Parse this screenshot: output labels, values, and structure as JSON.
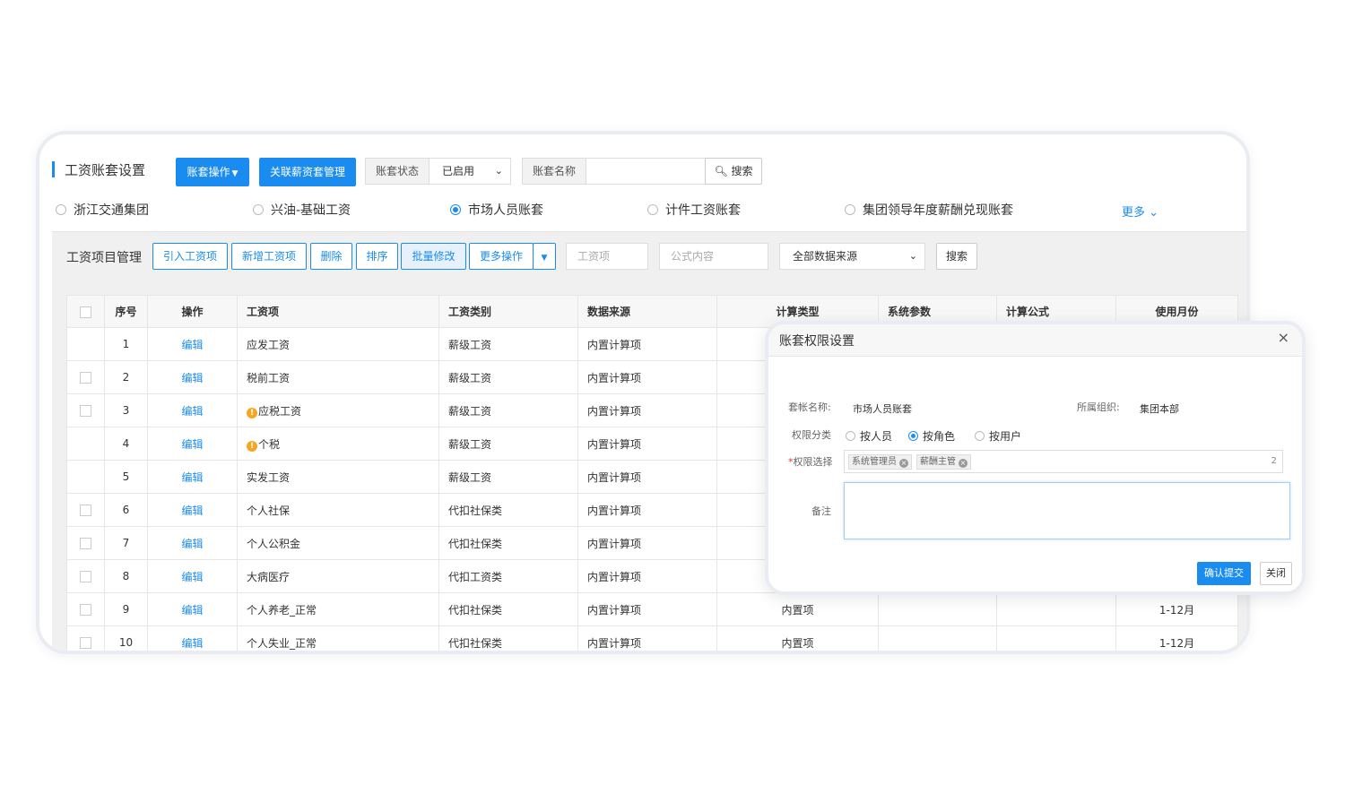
{
  "header": {
    "title": "工资账套设置",
    "account_ops_label": "账套操作",
    "link_manage_label": "关联薪资套管理",
    "status_label": "账套状态",
    "status_value": "已启用",
    "name_label": "账套名称",
    "name_value": "",
    "search_label": "搜索"
  },
  "accounts": {
    "items": [
      "浙江交通集团",
      "兴油-基础工资",
      "市场人员账套",
      "计件工资账套",
      "集团领导年度薪酬兑现账套"
    ],
    "selected_index": 2,
    "more_label": "更多"
  },
  "toolbar": {
    "label": "工资项目管理",
    "import_label": "引入工资项",
    "add_label": "新增工资项",
    "delete_label": "删除",
    "sort_label": "排序",
    "batch_label": "批量修改",
    "more_label": "更多操作",
    "item_placeholder": "工资项",
    "formula_placeholder": "公式内容",
    "source_value": "全部数据来源",
    "search_label": "搜索"
  },
  "table": {
    "columns": [
      "序号",
      "操作",
      "工资项",
      "工资类别",
      "数据来源",
      "计算类型",
      "系统参数",
      "计算公式",
      "使用月份"
    ],
    "rows": [
      {
        "no": "1",
        "op": "编辑",
        "item": "应发工资",
        "warn": false,
        "cat": "薪级工资",
        "src": "内置计算项",
        "calc": "",
        "param": "",
        "formula": "",
        "month": "",
        "checkbox": false
      },
      {
        "no": "2",
        "op": "编辑",
        "item": "税前工资",
        "warn": false,
        "cat": "薪级工资",
        "src": "内置计算项",
        "calc": "",
        "param": "",
        "formula": "",
        "month": "",
        "checkbox": true
      },
      {
        "no": "3",
        "op": "编辑",
        "item": "应税工资",
        "warn": true,
        "cat": "薪级工资",
        "src": "内置计算项",
        "calc": "",
        "param": "",
        "formula": "",
        "month": "",
        "checkbox": true
      },
      {
        "no": "4",
        "op": "编辑",
        "item": "个税",
        "warn": true,
        "cat": "薪级工资",
        "src": "内置计算项",
        "calc": "",
        "param": "",
        "formula": "",
        "month": "",
        "checkbox": false
      },
      {
        "no": "5",
        "op": "编辑",
        "item": "实发工资",
        "warn": false,
        "cat": "薪级工资",
        "src": "内置计算项",
        "calc": "",
        "param": "",
        "formula": "",
        "month": "",
        "checkbox": false
      },
      {
        "no": "6",
        "op": "编辑",
        "item": "个人社保",
        "warn": false,
        "cat": "代扣社保类",
        "src": "内置计算项",
        "calc": "",
        "param": "",
        "formula": "",
        "month": "",
        "checkbox": true
      },
      {
        "no": "7",
        "op": "编辑",
        "item": "个人公积金",
        "warn": false,
        "cat": "代扣社保类",
        "src": "内置计算项",
        "calc": "",
        "param": "",
        "formula": "",
        "month": "",
        "checkbox": true
      },
      {
        "no": "8",
        "op": "编辑",
        "item": "大病医疗",
        "warn": false,
        "cat": "代扣工资类",
        "src": "内置计算项",
        "calc": "",
        "param": "",
        "formula": "",
        "month": "",
        "checkbox": true
      },
      {
        "no": "9",
        "op": "编辑",
        "item": "个人养老_正常",
        "warn": false,
        "cat": "代扣社保类",
        "src": "内置计算项",
        "calc": "内置项",
        "param": "",
        "formula": "",
        "month": "1-12月",
        "checkbox": true
      },
      {
        "no": "10",
        "op": "编辑",
        "item": "个人失业_正常",
        "warn": false,
        "cat": "代扣社保类",
        "src": "内置计算项",
        "calc": "内置项",
        "param": "",
        "formula": "",
        "month": "1-12月",
        "checkbox": true
      }
    ]
  },
  "dialog": {
    "title": "账套权限设置",
    "close_icon": "×",
    "set_name_label": "套帐名称:",
    "set_name_value": "市场人员账套",
    "org_label": "所属组织:",
    "org_value": "集团本部",
    "perm_type_label": "权限分类",
    "perm_options": [
      "按人员",
      "按角色",
      "按用户"
    ],
    "perm_selected_index": 1,
    "perm_select_label": "权限选择",
    "perm_tags": [
      "系统管理员",
      "薪酬主管"
    ],
    "perm_count": "2",
    "remark_label": "备注",
    "remark_value": "",
    "submit_label": "确认提交",
    "close_label": "关闭"
  },
  "colors": {
    "accent": "#1a8cf0",
    "warning": "#f5a623"
  }
}
